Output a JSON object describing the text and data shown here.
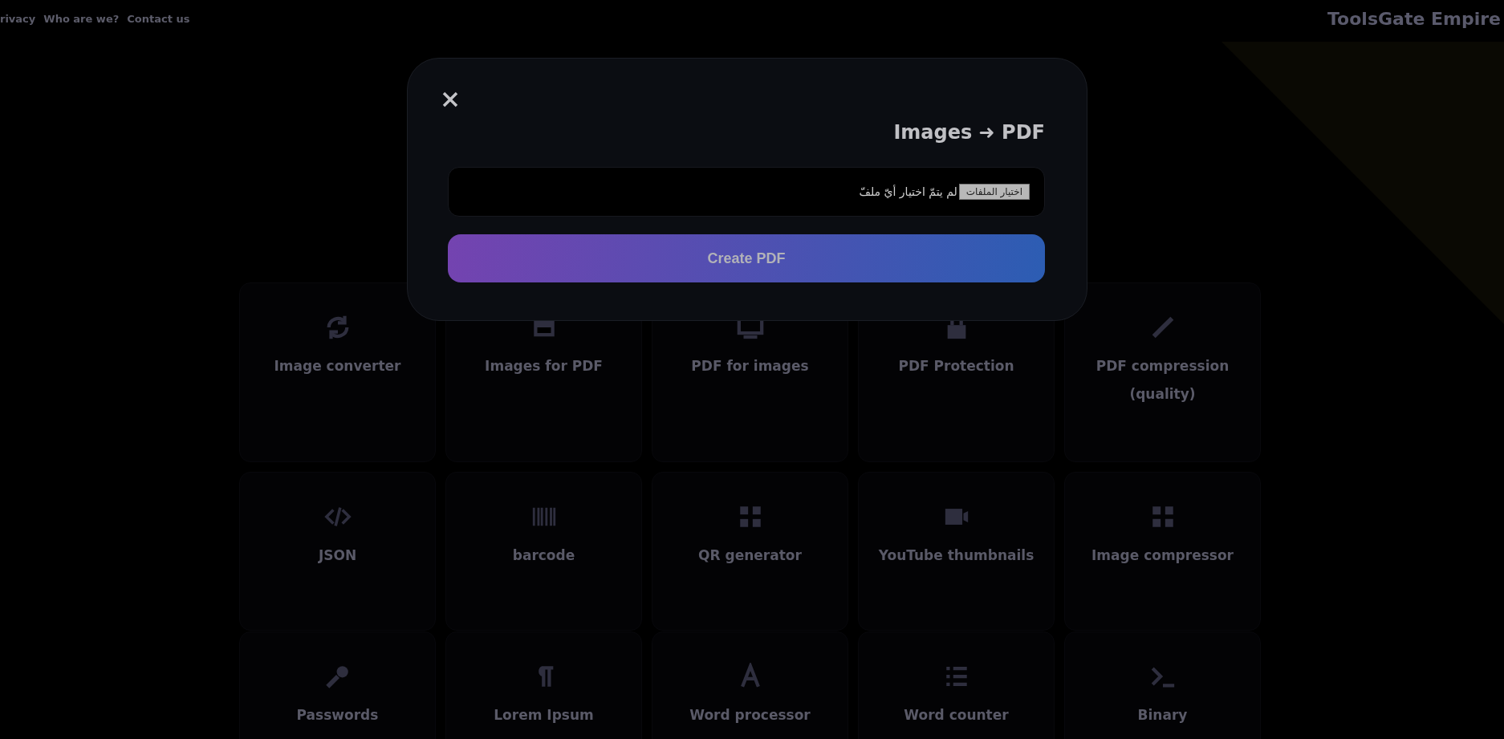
{
  "nav": {
    "links": [
      "rivacy",
      "Who are we?",
      "Contact us"
    ]
  },
  "brand": "ToolsGate Empire",
  "tools": [
    {
      "label": "Image converter"
    },
    {
      "label": "Images for PDF"
    },
    {
      "label": "PDF for images"
    },
    {
      "label": "PDF Protection"
    },
    {
      "label": "PDF compression (quality)"
    },
    {
      "label": "JSON"
    },
    {
      "label": "barcode"
    },
    {
      "label": "QR generator"
    },
    {
      "label": "YouTube thumbnails"
    },
    {
      "label": "Image compressor"
    },
    {
      "label": "Passwords"
    },
    {
      "label": "Lorem Ipsum"
    },
    {
      "label": "Word processor"
    },
    {
      "label": "Word counter"
    },
    {
      "label": "Binary"
    }
  ],
  "modal": {
    "title": "Images ➜ PDF",
    "file_button": "اختيار الملفات",
    "file_status": "لم يتمّ اختيار أيّ ملفّ",
    "submit": "Create PDF"
  }
}
